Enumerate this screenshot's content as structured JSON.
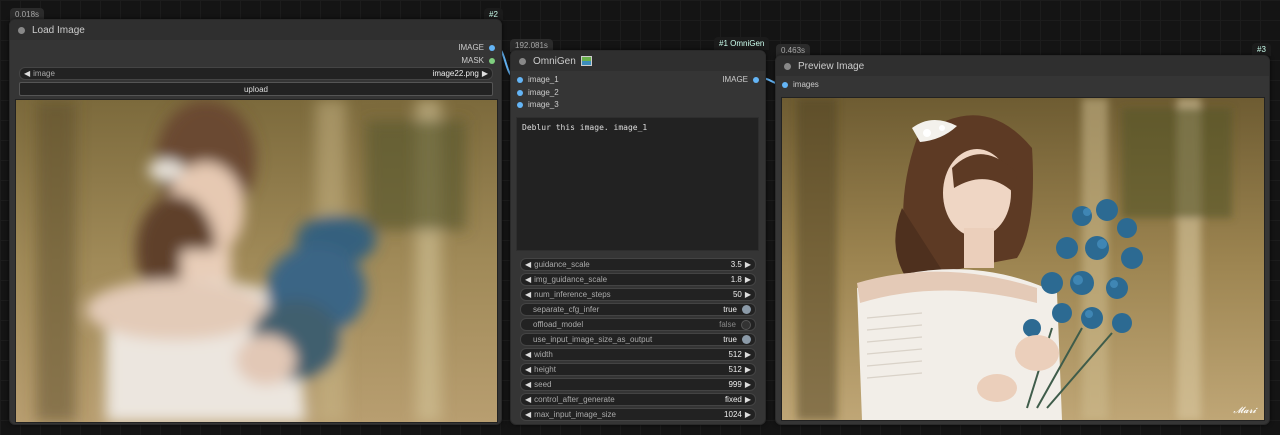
{
  "load_node": {
    "time": "0.018s",
    "id": "#2",
    "title": "Load Image",
    "outputs": [
      "IMAGE",
      "MASK"
    ],
    "image_widget": {
      "label": "image",
      "value": "image22.png"
    },
    "upload_label": "upload"
  },
  "omnigen_node": {
    "time": "192.081s",
    "id": "#1 OmniGen",
    "title": "OmniGen",
    "inputs": [
      "image_1",
      "image_2",
      "image_3"
    ],
    "output": "IMAGE",
    "prompt": "Deblur this image. image_1",
    "widgets": [
      {
        "label": "guidance_scale",
        "value": "3.5",
        "kind": "number"
      },
      {
        "label": "img_guidance_scale",
        "value": "1.8",
        "kind": "number"
      },
      {
        "label": "num_inference_steps",
        "value": "50",
        "kind": "number"
      },
      {
        "label": "separate_cfg_infer",
        "value": "true",
        "kind": "toggle"
      },
      {
        "label": "offload_model",
        "value": "false",
        "kind": "toggle"
      },
      {
        "label": "use_input_image_size_as_output",
        "value": "true",
        "kind": "toggle"
      },
      {
        "label": "width",
        "value": "512",
        "kind": "number"
      },
      {
        "label": "height",
        "value": "512",
        "kind": "number"
      },
      {
        "label": "seed",
        "value": "999",
        "kind": "number"
      },
      {
        "label": "control_after_generate",
        "value": "fixed",
        "kind": "number"
      },
      {
        "label": "max_input_image_size",
        "value": "1024",
        "kind": "number"
      }
    ]
  },
  "preview_node": {
    "time": "0.463s",
    "id": "#3",
    "title": "Preview Image",
    "input": "images"
  },
  "colors": {
    "slot_blue": "#64b5f6",
    "slot_green": "#7fcf7f",
    "link_blue": "#64b5f6"
  }
}
